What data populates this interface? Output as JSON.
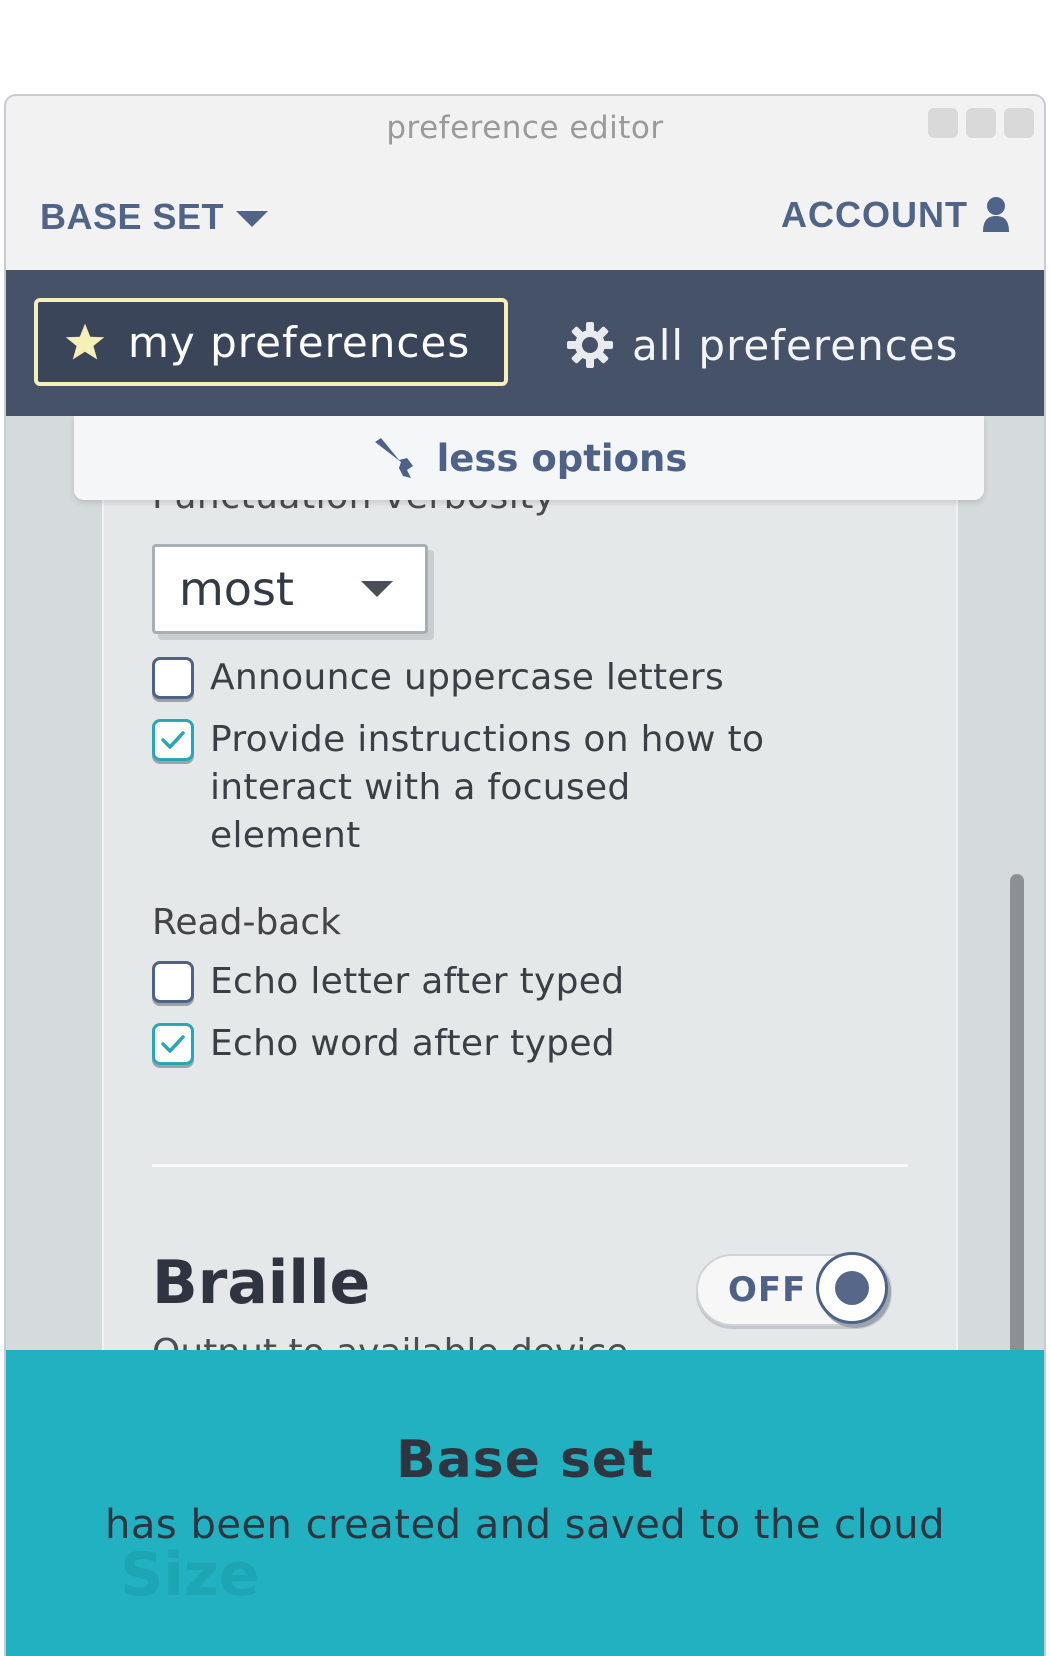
{
  "window": {
    "title": "preference editor"
  },
  "header": {
    "base_set_label": "BASE SET",
    "account_label": "ACCOUNT"
  },
  "tabs": {
    "my_preferences": "my preferences",
    "all_preferences": "all preferences"
  },
  "less_options": "less options",
  "speech": {
    "punctuation_label": "Punctuation verbosity",
    "punctuation_value": "most",
    "checkboxes": [
      {
        "label": "Announce uppercase letters",
        "checked": false
      },
      {
        "label": "Provide instructions on how to interact with a focused element",
        "checked": true
      }
    ],
    "readback_label": "Read-back",
    "readback": [
      {
        "label": "Echo letter after typed",
        "checked": false
      },
      {
        "label": "Echo word after typed",
        "checked": true
      }
    ]
  },
  "braille": {
    "title": "Braille",
    "subtitle": "Output to available device",
    "toggle_label": "OFF"
  },
  "toast": {
    "title": "Base set",
    "message": "has been created and saved to the cloud",
    "behind_text": "Size"
  },
  "colors": {
    "accent": "#21b1c0",
    "nav": "#465268",
    "highlight": "#f6efb8",
    "primary_text": "#4f6486"
  }
}
